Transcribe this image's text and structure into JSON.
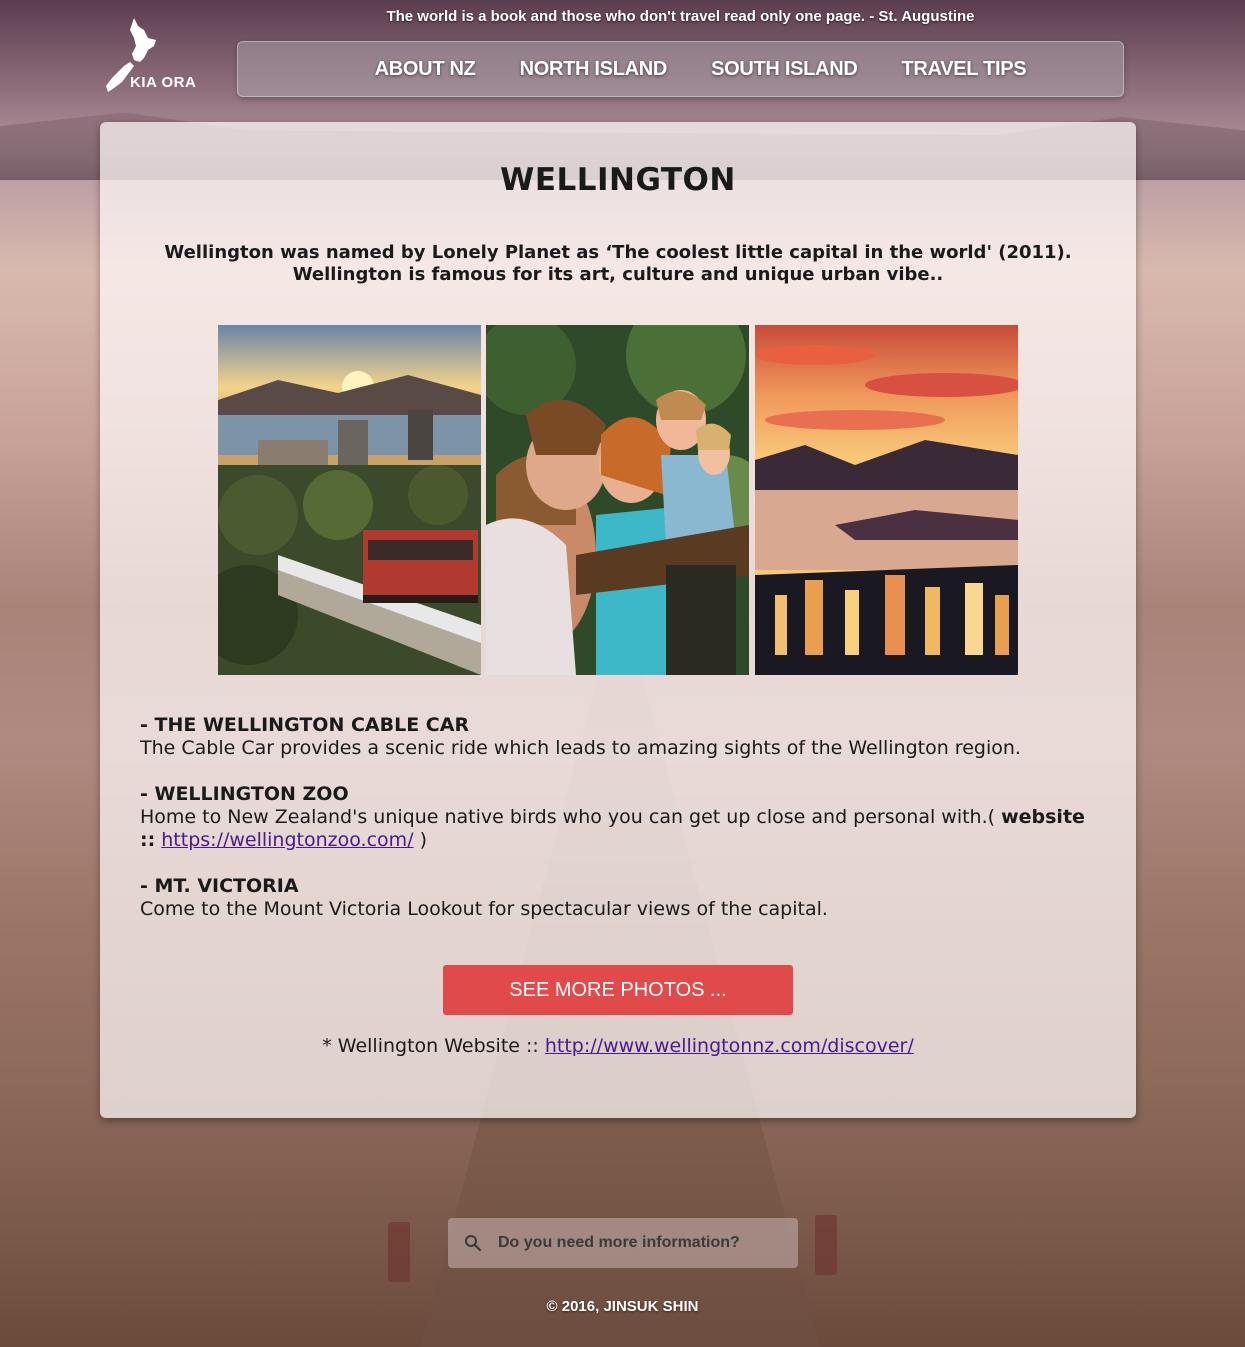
{
  "header": {
    "quote": "The world is a book and those who don't travel read only one page.  - St. Augustine",
    "logo_text": "KIA ORA"
  },
  "nav": {
    "items": [
      {
        "label": "ABOUT NZ"
      },
      {
        "label": "NORTH ISLAND"
      },
      {
        "label": "SOUTH ISLAND"
      },
      {
        "label": "TRAVEL TIPS"
      }
    ]
  },
  "main": {
    "title": "WELLINGTON",
    "intro": "Wellington was named by Lonely Planet as ‘The coolest little capital in the world' (2011). Wellington is famous for its art, culture and unique urban vibe..",
    "attractions": [
      {
        "heading": "- THE WELLINGTON CABLE CAR",
        "text": "The Cable Car provides a scenic ride which leads to amazing sights of the Wellington region."
      },
      {
        "heading": "- WELLINGTON ZOO",
        "text": "Home to New Zealand's unique native birds who you can get up close and personal with.",
        "website_open": "( ",
        "website_label": "website ::",
        "website_url": "https://wellingtonzoo.com/",
        "website_close": " )"
      },
      {
        "heading": "- MT. VICTORIA",
        "text": "Come to the Mount Victoria Lookout for spectacular views of the capital."
      }
    ],
    "more_button": "SEE MORE PHOTOS ...",
    "site_label": "* Wellington Website :: ",
    "site_url": "http://www.wellingtonnz.com/discover/"
  },
  "search": {
    "placeholder": "Do you need more information?"
  },
  "footer": {
    "copyright": "© 2016,  JINSUK SHIN"
  }
}
